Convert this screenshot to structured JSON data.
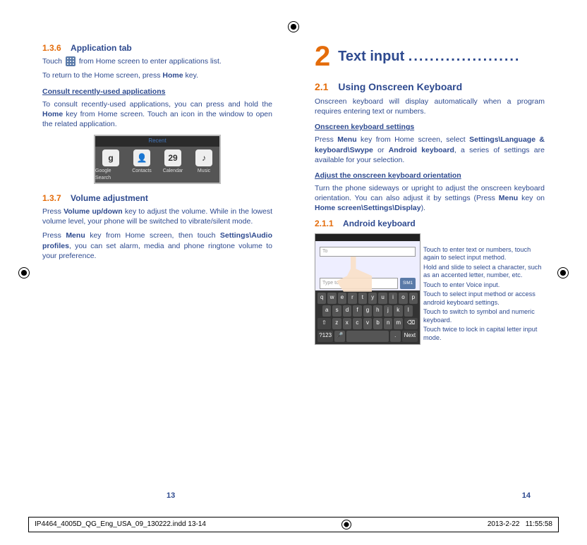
{
  "left": {
    "s136": {
      "num": "1.3.6",
      "title": "Application tab"
    },
    "s136_p1a": "Touch ",
    "s136_p1b": " from Home screen to enter applications list.",
    "s136_p2a": "To return to the Home screen, press ",
    "s136_p2b": "Home",
    "s136_p2c": " key.",
    "consult_head": "Consult recently-used applications",
    "consult_p_a": "To consult recently-used applications, you can press and hold the ",
    "consult_p_b": "Home",
    "consult_p_c": " key from Home screen. Touch an icon in the window to open the related application.",
    "apps_bar": "Recent",
    "apps": [
      "Google Search",
      "Contacts",
      "Calendar",
      "Music"
    ],
    "app_glyphs": [
      "g",
      "👤",
      "29",
      "♪"
    ],
    "s137": {
      "num": "1.3.7",
      "title": "Volume adjustment"
    },
    "s137_p1a": "Press ",
    "s137_p1b": "Volume up/down",
    "s137_p1c": " key to adjust the volume. While in the lowest volume level, your phone will be switched to vibrate/silent mode.",
    "s137_p2a": "Press ",
    "s137_p2b": "Menu",
    "s137_p2c": " key from Home screen, then touch ",
    "s137_p2d": "Settings\\Audio profiles",
    "s137_p2e": ", you can set alarm, media and phone ringtone volume to your preference.",
    "page_num": "13"
  },
  "right": {
    "chapter_num": "2",
    "chapter_title": "Text input ",
    "chapter_dots": ".....................",
    "s21": {
      "num": "2.1",
      "title": "Using Onscreen Keyboard"
    },
    "s21_p1": "Onscreen keyboard will display automatically when a program requires entering text or numbers.",
    "kb_set_head": "Onscreen keyboard settings",
    "kb_set_p_a": "Press ",
    "kb_set_p_b": "Menu",
    "kb_set_p_c": " key from Home screen, select ",
    "kb_set_p_d": "Settings\\Language & keyboard\\Swype",
    "kb_set_p_e": " or ",
    "kb_set_p_f": "Android keyboard",
    "kb_set_p_g": ", a series of settings are available for your selection.",
    "orient_head": "Adjust the onscreen keyboard orientation",
    "orient_p_a": "Turn the phone sideways or upright to adjust the onscreen keyboard orientation. You can also adjust it by settings (Press ",
    "orient_p_b": "Menu",
    "orient_p_c": " key on ",
    "orient_p_d": "Home screen\\Settings\\Display",
    "orient_p_e": ").",
    "s211": {
      "num": "2.1.1",
      "title": "Android keyboard"
    },
    "shot": {
      "to_placeholder": "To",
      "type_placeholder": "Type to",
      "sim_label": "SIM1",
      "row1": [
        "q",
        "w",
        "e",
        "r",
        "t",
        "y",
        "u",
        "i",
        "o",
        "p"
      ],
      "row2": [
        "a",
        "s",
        "d",
        "f",
        "g",
        "h",
        "j",
        "k",
        "l"
      ],
      "row3": [
        "⇧",
        "z",
        "x",
        "c",
        "v",
        "b",
        "n",
        "m",
        "⌫"
      ],
      "row4": [
        "?123",
        "🎤",
        " ",
        ".",
        "Next"
      ]
    },
    "callouts": {
      "c1": "Touch to enter text or numbers, touch again to select input method.",
      "c2": "Hold and slide to select a character, such as an accented letter, number, etc.",
      "c3": "Touch to enter Voice input.",
      "c4": "Touch to select input method or access android keyboard settings.",
      "c5": "Touch to switch to symbol and numeric keyboard.",
      "c6": "Touch twice to lock in capital letter input mode."
    },
    "page_num": "14"
  },
  "footer": {
    "file": "IP4464_4005D_QG_Eng_USA_09_130222.indd   13-14",
    "date": "2013-2-22",
    "time": "11:55:58"
  }
}
